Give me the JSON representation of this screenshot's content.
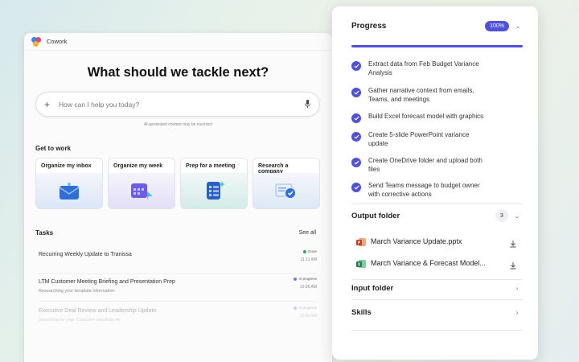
{
  "window": {
    "title": "Cowork"
  },
  "hero": {
    "title": "What should we tackle next?"
  },
  "search": {
    "placeholder": "How can I help you today?",
    "disclaimer": "AI-generated content may be incorrect"
  },
  "get_to_work": {
    "title": "Get to work",
    "cards": [
      {
        "label": "Organize my inbox",
        "icon": "envelope-icon"
      },
      {
        "label": "Organize my week",
        "icon": "calendar-icon"
      },
      {
        "label": "Prep for a meeting",
        "icon": "checklist-icon"
      },
      {
        "label": "Research a company",
        "icon": "research-icon"
      }
    ]
  },
  "tasks": {
    "title": "Tasks",
    "see_all": "See all",
    "items": [
      {
        "title": "Recurring Weekly Update to Tranissa",
        "subtitle": "",
        "status": "Done",
        "status_color": "#3aa35b",
        "time": "11:11 AM"
      },
      {
        "title": "LTM Customer Meeting Briefing and Presentation Prep",
        "subtitle": "Researching your template information.",
        "status": "In progress",
        "status_color": "#6b7fe0",
        "time": "10:36 AM"
      },
      {
        "title": "Executive Deal Review and Leadership Update",
        "subtitle": "Searching for your Customer meetings for",
        "status": "In progress",
        "status_color": "#6b7fe0",
        "time": "10:03 AM"
      }
    ]
  },
  "progress_panel": {
    "title": "Progress",
    "percent_label": "100%",
    "progress_fraction": 1.0,
    "accent": "#4f52d8",
    "steps": [
      {
        "line1": "Extract data from Feb Budget Variance",
        "line2": "Analysis"
      },
      {
        "line1": "Gather narrative context from emails,",
        "line2": "Teams, and meetings"
      },
      {
        "line1": "Build Excel forecast model with graphics",
        "line2": ""
      },
      {
        "line1": "Create 5-slide PowerPoint variance",
        "line2": "update"
      },
      {
        "line1": "Create OneDrive folder and upload both",
        "line2": "files"
      },
      {
        "line1": "Send Teams message to budget owner",
        "line2": "with corrective actions"
      }
    ],
    "output_folder": {
      "title": "Output folder",
      "count": "3",
      "files": [
        {
          "name": "March Variance Update.pptx",
          "type": "powerpoint"
        },
        {
          "name": "March Variance & Forecast Model...",
          "type": "excel"
        }
      ]
    },
    "input_folder": {
      "title": "Input folder"
    },
    "skills": {
      "title": "Skills"
    }
  }
}
